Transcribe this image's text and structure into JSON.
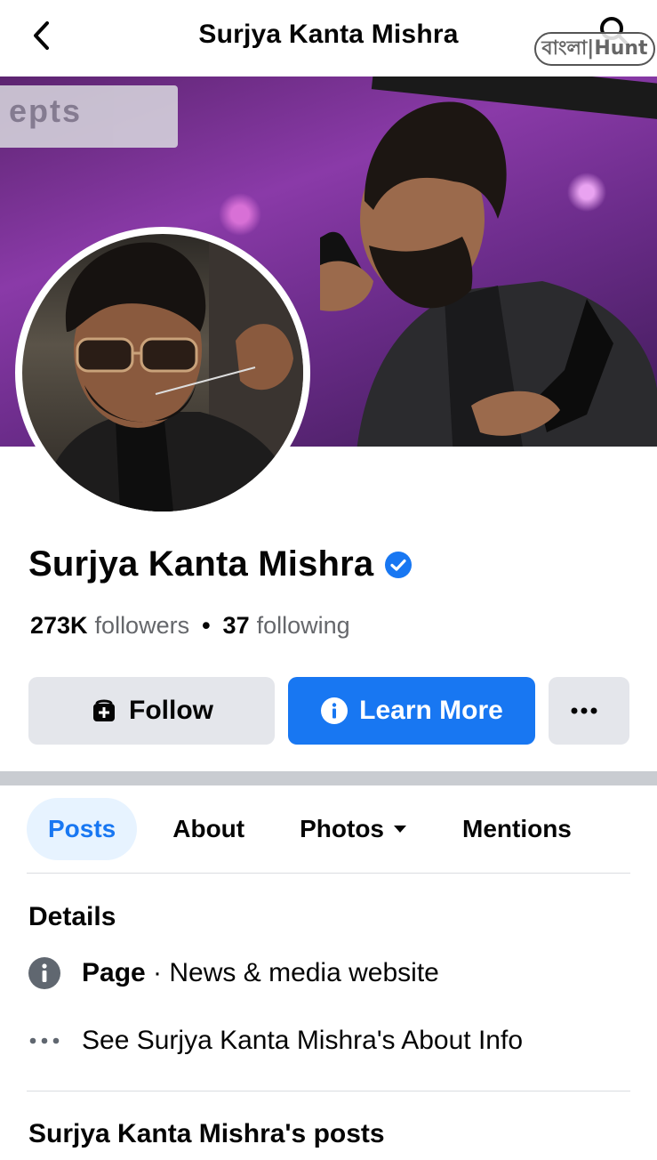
{
  "topbar": {
    "title": "Surjya Kanta Mishra",
    "back_icon": "chevron-left-icon",
    "search_icon": "search-icon"
  },
  "watermark": {
    "text": "বাংলা|Hunt"
  },
  "cover": {
    "sign_text": "epts"
  },
  "profile": {
    "name": "Surjya Kanta Mishra",
    "verified_icon": "verified-badge-icon",
    "followers_count": "273K",
    "followers_label": "followers",
    "separator": "•",
    "following_count": "37",
    "following_label": "following"
  },
  "actions": {
    "follow_label": "Follow",
    "learn_more_label": "Learn More",
    "more_icon": "more-options-icon"
  },
  "tabs": [
    {
      "label": "Posts",
      "active": true
    },
    {
      "label": "About",
      "active": false
    },
    {
      "label": "Photos",
      "active": false
    },
    {
      "label": "Mentions",
      "active": false
    }
  ],
  "details": {
    "title": "Details",
    "page_type_bold": "Page",
    "page_type_rest": " · News & media website",
    "about_link": "See Surjya Kanta Mishra's About Info"
  },
  "posts_section": {
    "title": "Surjya Kanta Mishra's posts"
  },
  "colors": {
    "accent": "#1877f2",
    "accent_light": "#e7f3ff",
    "button_gray": "#e4e6eb",
    "secondary_text": "#65676b"
  }
}
